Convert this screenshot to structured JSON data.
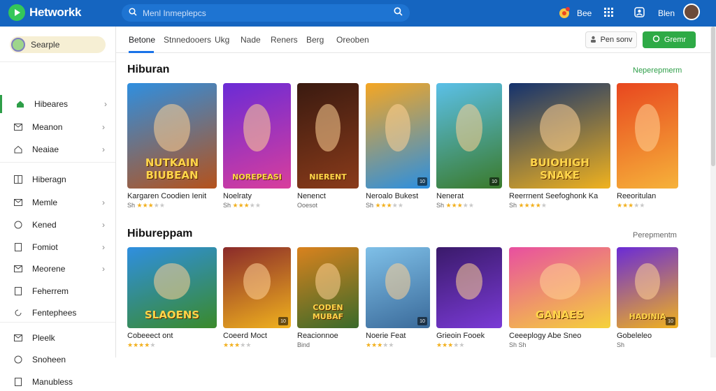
{
  "app": {
    "title": "Hetworkk"
  },
  "search": {
    "placeholder": "Menl Inmeplepcs"
  },
  "topbar": {
    "label1": "Bee",
    "label2": "Blen"
  },
  "sidebar": {
    "search_label": "Searple",
    "items": [
      {
        "label": "Hibeares",
        "icon": "home-icon",
        "chevron": true,
        "active": true
      },
      {
        "label": "Meanon",
        "icon": "mail-icon",
        "chevron": true
      },
      {
        "label": "Neaiae",
        "icon": "home-outline-icon",
        "chevron": true
      },
      {
        "label": "Hiberagn",
        "icon": "grid-icon",
        "chevron": false
      },
      {
        "label": "Memle",
        "icon": "mail-icon",
        "chevron": true
      },
      {
        "label": "Kened",
        "icon": "circle-icon",
        "chevron": true
      },
      {
        "label": "Fomiot",
        "icon": "doc-icon",
        "chevron": true
      },
      {
        "label": "Meorene",
        "icon": "mail-icon",
        "chevron": true
      },
      {
        "label": "Feherrem",
        "icon": "doc-icon",
        "chevron": false
      },
      {
        "label": "Fentephees",
        "icon": "refresh-icon",
        "chevron": false
      },
      {
        "label": "Pleelk",
        "icon": "mail-icon",
        "chevron": false
      },
      {
        "label": "Snoheen",
        "icon": "circle-icon",
        "chevron": false
      },
      {
        "label": "Manubless",
        "icon": "doc-icon",
        "chevron": false
      }
    ]
  },
  "tabs": [
    "Betone",
    "Stnnedooers",
    "Ukg",
    "Nade",
    "Reners",
    "Berg",
    "Oreoben"
  ],
  "buttons": {
    "outline_label": "Pen sonv",
    "green_label": "Gremr"
  },
  "sections": [
    {
      "title": "Hiburan",
      "link": "Neperepmerm",
      "link_color": "#2e9e48",
      "cards": [
        {
          "name": "Kargaren Coodien Ienit",
          "rating_text": "Sh",
          "stars": 3,
          "meta": "",
          "art": "NUTKAIN BIUBEAN",
          "colors": [
            "#2f8fe0",
            "#b5521b"
          ],
          "badge": ""
        },
        {
          "name": "Noelraty",
          "rating_text": "Sh",
          "stars": 3,
          "meta": "",
          "art": "NOREPEASI",
          "colors": [
            "#6a2bd6",
            "#d93e9c"
          ],
          "badge": ""
        },
        {
          "name": "Nenenct",
          "rating_text": "",
          "stars": 0,
          "meta": "Ooesot",
          "art": "NIERENT",
          "colors": [
            "#3a1a10",
            "#8a3b1a"
          ],
          "badge": ""
        },
        {
          "name": "Neroalo Bukest",
          "rating_text": "Sh",
          "stars": 3,
          "meta": "",
          "art": "",
          "colors": [
            "#f5a623",
            "#2b8fe0"
          ],
          "badge": "10"
        },
        {
          "name": "Nenerat",
          "rating_text": "Sh",
          "stars": 3,
          "meta": "",
          "art": "",
          "colors": [
            "#5bc0e8",
            "#3a7a2a"
          ],
          "badge": "10"
        },
        {
          "name": "Reerrnent Seefoghonk Ka",
          "rating_text": "Sh",
          "stars": 4,
          "meta": "",
          "art": "BUIOHIGH SNAKE",
          "colors": [
            "#14326e",
            "#f0b21e"
          ],
          "badge": ""
        },
        {
          "name": "Reeoritulan",
          "rating_text": "",
          "stars": 3,
          "meta": "",
          "art": "",
          "colors": [
            "#e8471f",
            "#f6b23a"
          ],
          "badge": ""
        }
      ]
    },
    {
      "title": "Hibureppam",
      "link": "Perepmentm",
      "link_color": "#666666",
      "cards": [
        {
          "name": "Cobeeect ont",
          "rating_text": "",
          "stars": 4,
          "meta": "",
          "art": "SLAOENS",
          "colors": [
            "#2f8fe0",
            "#3a8a2a"
          ],
          "badge": ""
        },
        {
          "name": "Coeerd Moct",
          "rating_text": "",
          "stars": 3,
          "meta": "",
          "art": "",
          "colors": [
            "#8a2a2a",
            "#f0b21e"
          ],
          "badge": "10"
        },
        {
          "name": "Reacionnoe",
          "rating_text": "",
          "stars": 0,
          "meta": "Bind",
          "art": "CODEN MUBAF",
          "colors": [
            "#d9821e",
            "#3a6a2a"
          ],
          "badge": ""
        },
        {
          "name": "Noerie Feat",
          "rating_text": "",
          "stars": 3,
          "meta": "",
          "art": "",
          "colors": [
            "#7fc0e8",
            "#3a6a9a"
          ],
          "badge": "10"
        },
        {
          "name": "Grieoin Fooek",
          "rating_text": "",
          "stars": 3,
          "meta": "",
          "art": "",
          "colors": [
            "#3a1a6a",
            "#7a3ad6"
          ],
          "badge": ""
        },
        {
          "name": "Ceeeplogy Abe Sneo",
          "rating_text": "Sh",
          "stars": 0,
          "meta": "Sh",
          "art": "GANAES",
          "colors": [
            "#e84fa0",
            "#f5d23a"
          ],
          "badge": ""
        },
        {
          "name": "Gobeleleo",
          "rating_text": "",
          "stars": 0,
          "meta": "Sh",
          "art": "HADINIA",
          "colors": [
            "#6a2bd6",
            "#f0b21e"
          ],
          "badge": "10"
        }
      ]
    }
  ]
}
